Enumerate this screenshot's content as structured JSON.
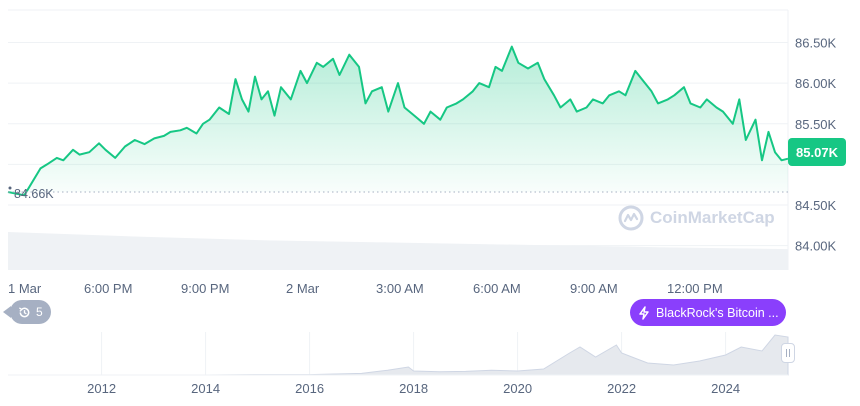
{
  "chart_data": {
    "type": "area",
    "price_axis": {
      "ticks": [
        "86.50K",
        "86.00K",
        "85.50K",
        "85.00K",
        "84.50K",
        "84.00K"
      ],
      "tick_values": [
        86500,
        86000,
        85500,
        85000,
        84500,
        84000
      ],
      "ylim": [
        83700,
        86900
      ]
    },
    "time_axis": {
      "ticks": [
        "1 Mar",
        "6:00 PM",
        "9:00 PM",
        "2 Mar",
        "3:00 AM",
        "6:00 AM",
        "9:00 AM",
        "12:00 PM"
      ],
      "xlim": [
        0,
        24
      ]
    },
    "series": [
      {
        "x": [
          0,
          0.5,
          1,
          1.2,
          1.5,
          1.7,
          2,
          2.2,
          2.5,
          2.8,
          3,
          3.3,
          3.6,
          3.9,
          4.2,
          4.5,
          4.8,
          5,
          5.3,
          5.5,
          5.8,
          6,
          6.2,
          6.5,
          6.8,
          7,
          7.2,
          7.4,
          7.6,
          7.8,
          8,
          8.2,
          8.4,
          8.7,
          9,
          9.2,
          9.5,
          9.7,
          10,
          10.2,
          10.5,
          10.8,
          11,
          11.2,
          11.5,
          11.7,
          12,
          12.2,
          12.5,
          12.8,
          13,
          13.3,
          13.5,
          13.8,
          14,
          14.3,
          14.5,
          14.8,
          15,
          15.2,
          15.5,
          15.7,
          16,
          16.3,
          16.5,
          16.8,
          17,
          17.3,
          17.5,
          17.8,
          18,
          18.3,
          18.5,
          18.8,
          19,
          19.3,
          19.5,
          19.8,
          20,
          20.3,
          20.5,
          20.8,
          21,
          21.3,
          21.5,
          21.8,
          22,
          22.3,
          22.5,
          22.7,
          23,
          23.2,
          23.4,
          23.6,
          23.8,
          24
        ],
        "y": [
          84660,
          84620,
          84950,
          85000,
          85080,
          85050,
          85180,
          85120,
          85150,
          85260,
          85180,
          85080,
          85220,
          85300,
          85250,
          85320,
          85350,
          85400,
          85420,
          85450,
          85380,
          85500,
          85550,
          85700,
          85620,
          86050,
          85800,
          85650,
          86080,
          85800,
          85900,
          85600,
          85950,
          85800,
          86150,
          86000,
          86250,
          86200,
          86300,
          86100,
          86350,
          86200,
          85750,
          85900,
          85950,
          85650,
          86000,
          85700,
          85600,
          85500,
          85650,
          85550,
          85700,
          85750,
          85800,
          85900,
          86000,
          85950,
          86200,
          86150,
          86450,
          86250,
          86180,
          86250,
          86050,
          85850,
          85700,
          85800,
          85650,
          85700,
          85800,
          85750,
          85850,
          85900,
          85850,
          86150,
          86050,
          85900,
          85750,
          85800,
          85850,
          85950,
          85750,
          85700,
          85800,
          85700,
          85650,
          85500,
          85800,
          85300,
          85550,
          85050,
          85400,
          85150,
          85050,
          85070
        ]
      }
    ],
    "baseline_value": 84660,
    "baseline_label": "84.66K",
    "current_price": "85.07K",
    "current_value": 85070,
    "volume": {
      "x": [
        0,
        4,
        8,
        12,
        16,
        20,
        24
      ],
      "values": [
        1.0,
        0.88,
        0.78,
        0.72,
        0.66,
        0.6,
        0.55
      ]
    },
    "navigator": {
      "ticks": [
        "2012",
        "2014",
        "2016",
        "2018",
        "2020",
        "2022",
        "2024"
      ],
      "x": [
        2010.5,
        2011,
        2012,
        2013,
        2014,
        2015,
        2016,
        2017,
        2017.5,
        2017.9,
        2018,
        2018.5,
        2019,
        2019.5,
        2020,
        2020.5,
        2021,
        2021.2,
        2021.5,
        2021.9,
        2022,
        2022.5,
        2023,
        2023.5,
        2024,
        2024.3,
        2024.7,
        2024.95,
        2025.2
      ],
      "values": [
        0,
        0,
        0,
        0,
        0,
        0.01,
        0.01,
        0.04,
        0.12,
        0.2,
        0.1,
        0.08,
        0.09,
        0.12,
        0.1,
        0.15,
        0.55,
        0.7,
        0.45,
        0.75,
        0.55,
        0.3,
        0.25,
        0.35,
        0.5,
        0.7,
        0.6,
        1.0,
        0.95
      ]
    },
    "colors": {
      "line": "#16c784",
      "area": "#16c784",
      "baseline": "#a6b0c3",
      "volume": "#eff2f5",
      "navigator_fill": "#e6e9ee",
      "axis_text": "#58667e"
    }
  },
  "ui": {
    "price_badge": "85.07K",
    "history_button": {
      "count": "5",
      "icon": "history-icon"
    },
    "news_button": {
      "label": "BlackRock's Bitcoin ...",
      "icon": "lightning-icon"
    },
    "watermark": "CoinMarketCap"
  }
}
